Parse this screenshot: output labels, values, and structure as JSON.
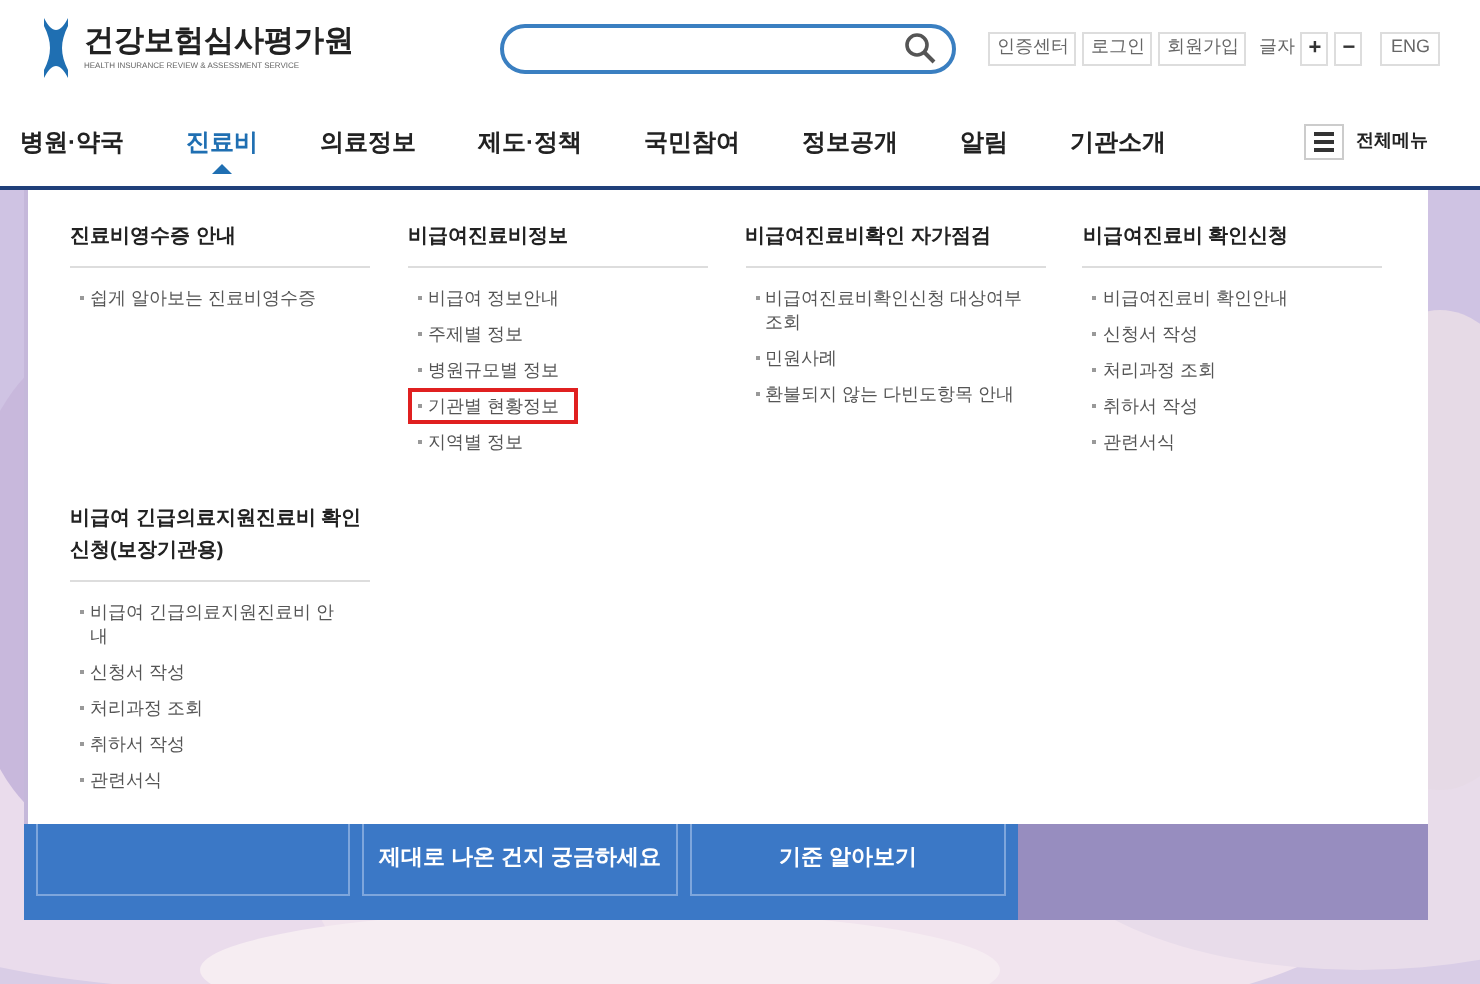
{
  "header": {
    "logo_title": "건강보험심사평가원",
    "logo_subtitle": "HEALTH INSURANCE REVIEW & ASSESSMENT SERVICE",
    "top_links": [
      "인증센터",
      "로그인",
      "회원가입"
    ],
    "font_size_label": "글자",
    "font_buttons": [
      "+",
      "−"
    ],
    "language": "ENG"
  },
  "nav": {
    "items": [
      {
        "label": "병원·약국",
        "selected": false
      },
      {
        "label": "진료비",
        "selected": true
      },
      {
        "label": "의료정보",
        "selected": false
      },
      {
        "label": "제도·정책",
        "selected": false
      },
      {
        "label": "국민참여",
        "selected": false
      },
      {
        "label": "정보공개",
        "selected": false
      },
      {
        "label": "알림",
        "selected": false
      },
      {
        "label": "기관소개",
        "selected": false
      }
    ],
    "all_menu": "전체메뉴"
  },
  "dropdown": {
    "columns": [
      {
        "title": "진료비영수증 안내",
        "links": [
          {
            "label": "쉽게 알아보는 진료비영수증",
            "highlighted": false
          }
        ]
      },
      {
        "title": "비급여진료비정보",
        "links": [
          {
            "label": "비급여 정보안내",
            "highlighted": false
          },
          {
            "label": "주제별 정보",
            "highlighted": false
          },
          {
            "label": "병원규모별 정보",
            "highlighted": false
          },
          {
            "label": "기관별 현황정보",
            "highlighted": true
          },
          {
            "label": "지역별 정보",
            "highlighted": false
          }
        ]
      },
      {
        "title": "비급여진료비확인 자가점검",
        "links": [
          {
            "label": "비급여진료비확인신청 대상여부 조회",
            "highlighted": false
          },
          {
            "label": "민원사례",
            "highlighted": false
          },
          {
            "label": "환불되지 않는 다빈도항목 안내",
            "highlighted": false
          }
        ]
      },
      {
        "title": "비급여진료비 확인신청",
        "links": [
          {
            "label": "비급여진료비 확인안내",
            "highlighted": false
          },
          {
            "label": "신청서 작성",
            "highlighted": false
          },
          {
            "label": "처리과정 조회",
            "highlighted": false
          },
          {
            "label": "취하서 작성",
            "highlighted": false
          },
          {
            "label": "관련서식",
            "highlighted": false
          }
        ]
      },
      {
        "title": "비급여 긴급의료지원진료비 확인신청(보장기관용)",
        "links": [
          {
            "label": "비급여 긴급의료지원진료비 안내",
            "highlighted": false
          },
          {
            "label": "신청서 작성",
            "highlighted": false
          },
          {
            "label": "처리과정 조회",
            "highlighted": false
          },
          {
            "label": "취하서 작성",
            "highlighted": false
          },
          {
            "label": "관련서식",
            "highlighted": false
          }
        ]
      }
    ]
  },
  "banner": {
    "cards": [
      {
        "text": "제대로 나온 건지 궁금하세요"
      },
      {
        "text": "**기준** 알아보기"
      }
    ]
  }
}
